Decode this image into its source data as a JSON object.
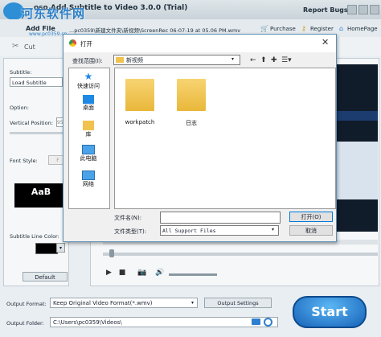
{
  "app": {
    "title": "Aiseesoft Video Converter Ultimate - Add Subtitle to Video 3.0.0 (Trial)",
    "title_visible": "oso Add Subtitle to Video 3.0.0 (Trial)",
    "report_bugs": "Report Bugs",
    "watermark_text": "河东软件网",
    "watermark_url": "www.pc0359.cn"
  },
  "header": {
    "add_file": "Add File",
    "path_text": "...pc0359\\新建文件夹\\新视频\\ScreenRec 06-07-19 at 05.06 PM.wmv",
    "links": [
      "Purchase",
      "Register",
      "HomePage"
    ]
  },
  "toolbar": {
    "cut": "Cut"
  },
  "left": {
    "subtitle_label": "Subtitle:",
    "subtitle_value": "Load Subtitle",
    "option_label": "Option:",
    "vertical_label": "Vertical Position:",
    "vertical_value": "95",
    "font_style_label": "Font Style:",
    "font_button": "F",
    "preview_text": "AaB",
    "line_color_label": "Subtitle Line Color:",
    "default_button": "Default"
  },
  "bottom": {
    "output_format_label": "Output Format:",
    "output_format_value": "Keep Original Video Format(*.wmv)",
    "output_settings": "Output Settings",
    "output_folder_label": "Output Folder:",
    "output_folder_value": "C:\\Users\\pc0359\\Videos\\",
    "start": "Start"
  },
  "dialog": {
    "title": "打开",
    "lookin_label": "查找范围(I):",
    "lookin_value": "新视频",
    "sidebar": [
      "快速访问",
      "桌面",
      "库",
      "此电脑",
      "网络"
    ],
    "files": [
      "workpatch",
      "日志"
    ],
    "filename_label": "文件名(N):",
    "filetype_label": "文件类型(T):",
    "filetype_value": "All Support Files",
    "open_button": "打开(O)",
    "cancel_button": "取消"
  },
  "colors": {
    "accent": "#1662b8",
    "watermark": "#2b7ec8",
    "line_color": "#000000"
  }
}
